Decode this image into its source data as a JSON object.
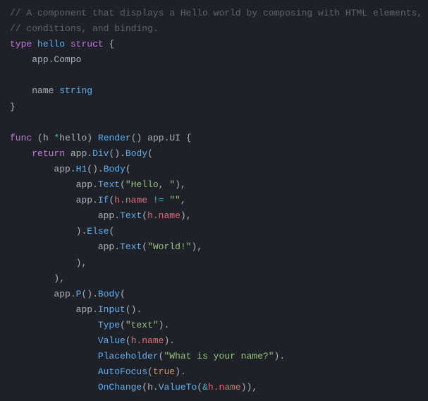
{
  "code": {
    "c1": "// A component that displays a Hello world by composing with HTML elements,",
    "c2": "// conditions, and binding.",
    "kw_type": "type",
    "name_hello": "hello",
    "kw_struct": "struct",
    "lb": "{",
    "rb": "}",
    "app_compo": "app.Compo",
    "field_name": "name",
    "type_string": "string",
    "kw_func": "func",
    "lp": "(",
    "rp": ")",
    "recv_h": "h",
    "star": "*",
    "recv_type": "hello",
    "fn_render": "Render",
    "ret_type": "app.UI",
    "kw_return": "return",
    "app": "app",
    "dot": ".",
    "m_div": "Div",
    "m_body": "Body",
    "m_h1": "H1",
    "m_text": "Text",
    "s_hello": "\"Hello, \"",
    "comma": ",",
    "m_if": "If",
    "h_name": "h.name",
    "neq": "!=",
    "s_empty": "\"\"",
    "m_else": "Else",
    "s_world": "\"World!\"",
    "m_p": "P",
    "m_input": "Input",
    "m_type": "Type",
    "s_text": "\"text\"",
    "m_value": "Value",
    "m_placeholder": "Placeholder",
    "s_prompt": "\"What is your name?\"",
    "m_autofocus": "AutoFocus",
    "v_true": "true",
    "m_onchange": "OnChange",
    "m_valueto": "ValueTo",
    "amp": "&"
  }
}
